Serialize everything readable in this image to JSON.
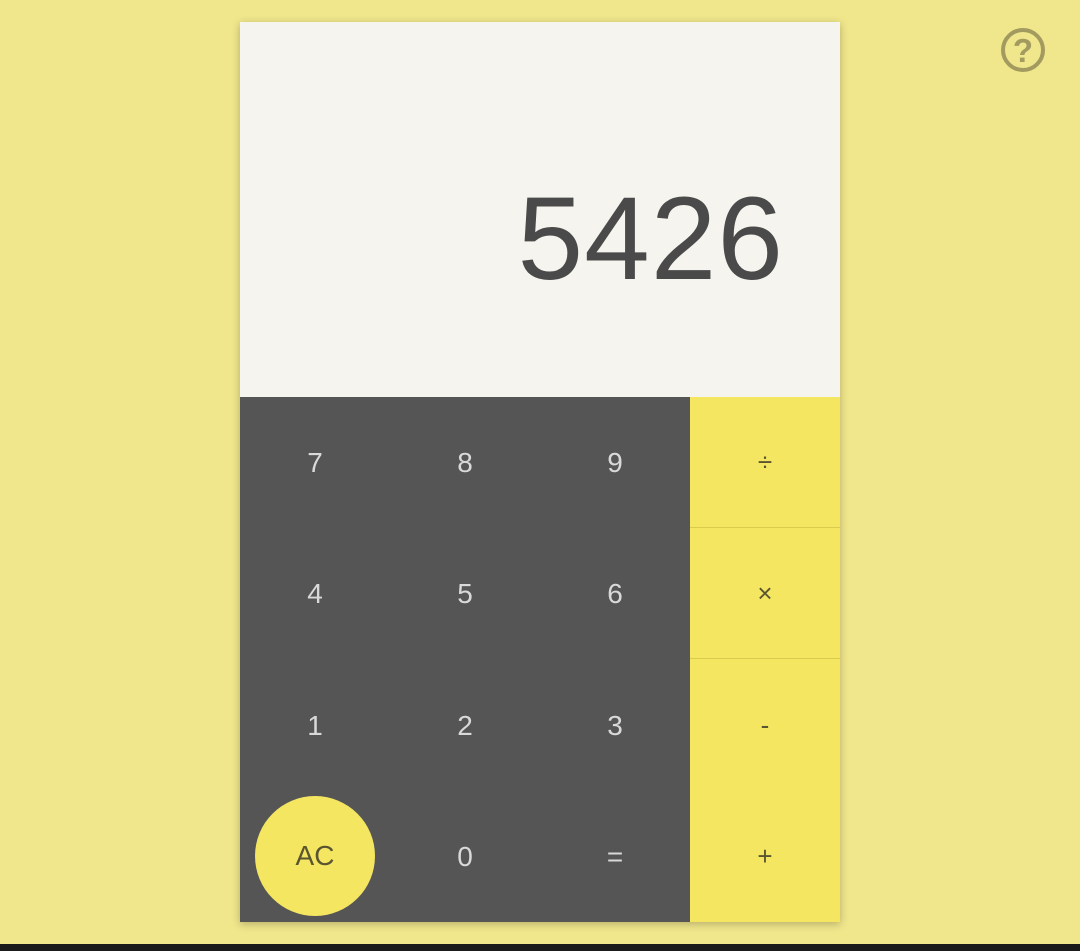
{
  "display": {
    "value": "5426"
  },
  "help": {
    "icon": "help-icon",
    "glyph": "?"
  },
  "keys": {
    "seven": "7",
    "eight": "8",
    "nine": "9",
    "four": "4",
    "five": "5",
    "six": "6",
    "one": "1",
    "two": "2",
    "three": "3",
    "clear": "AC",
    "zero": "0",
    "equals": "="
  },
  "operators": {
    "divide": "÷",
    "multiply": "×",
    "subtract": "-",
    "add": "+"
  },
  "colors": {
    "background": "#f0e68c",
    "display_bg": "#f6f4ee",
    "keypad_bg": "#555555",
    "accent": "#f4e661",
    "display_text": "#4a4a4a"
  }
}
